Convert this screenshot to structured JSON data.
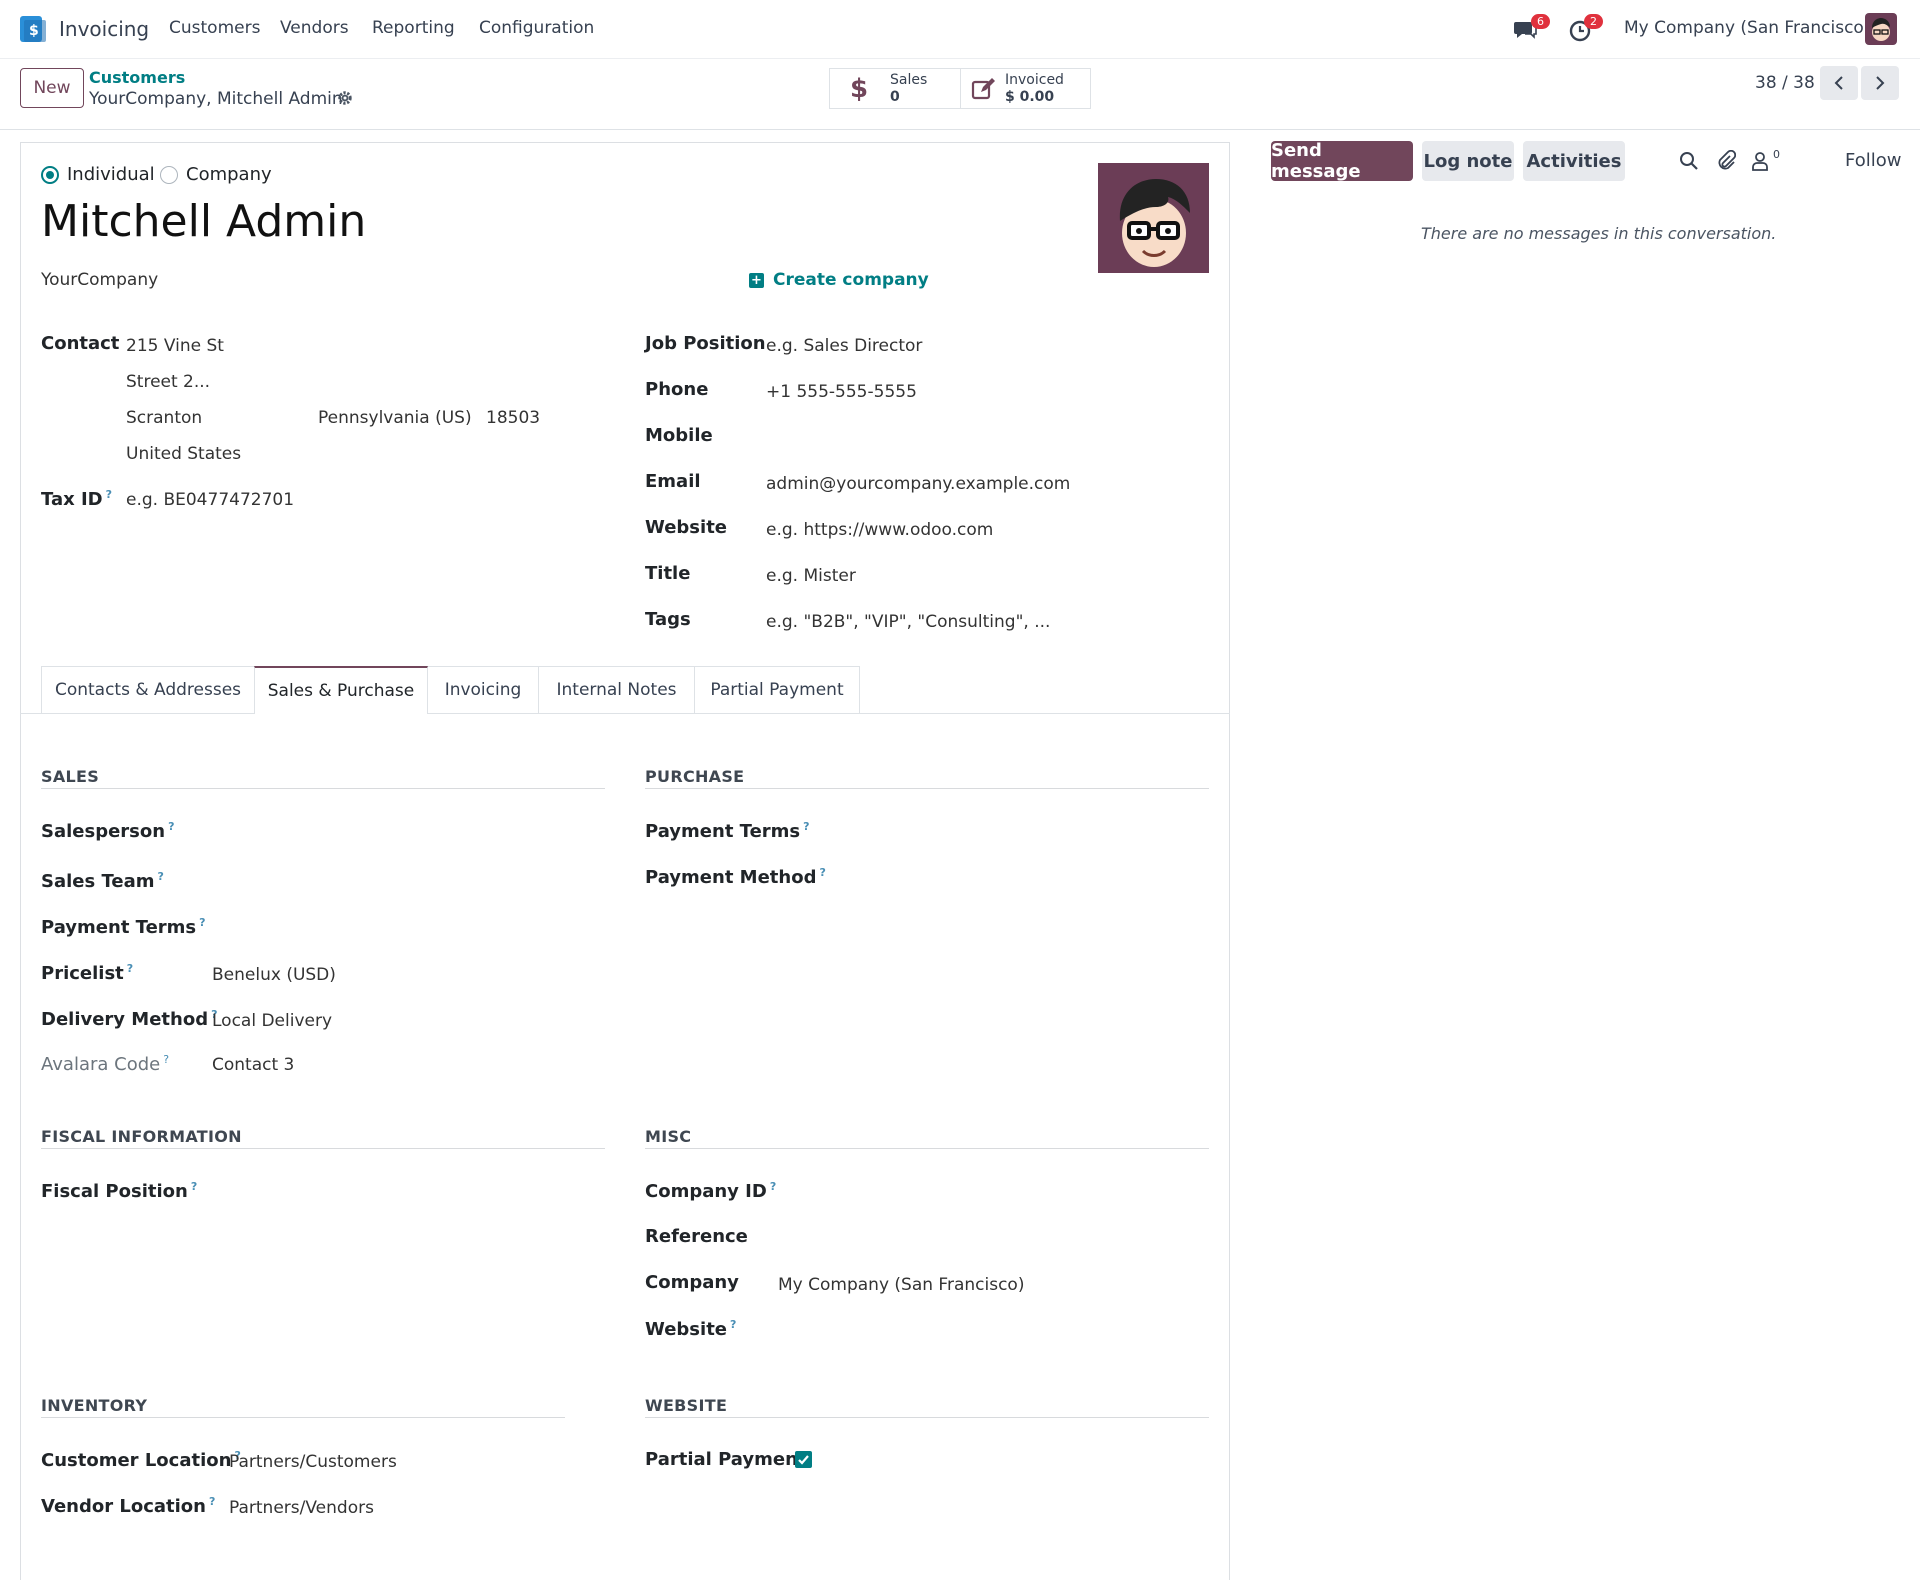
{
  "topbar": {
    "app_name": "Invoicing",
    "menu": [
      "Customers",
      "Vendors",
      "Reporting",
      "Configuration"
    ],
    "messages_badge": "6",
    "activities_badge": "2",
    "company": "My Company (San Francisco)"
  },
  "control": {
    "new_label": "New",
    "breadcrumb_parent": "Customers",
    "breadcrumb_current": "YourCompany, Mitchell Admin",
    "stat_sales_label": "Sales",
    "stat_sales_value": "0",
    "stat_invoiced_label": "Invoiced",
    "stat_invoiced_value": "$ 0.00",
    "pager": "38 / 38"
  },
  "form": {
    "type_individual": "Individual",
    "type_company": "Company",
    "name": "Mitchell Admin",
    "parent_company": "YourCompany",
    "create_company": "Create company",
    "contact_label": "Contact",
    "street": "215 Vine St",
    "street2_placeholder": "Street 2...",
    "city": "Scranton",
    "state": "Pennsylvania (US)",
    "zip": "18503",
    "country": "United States",
    "taxid_label": "Tax ID",
    "taxid_placeholder": "e.g. BE0477472701",
    "job_label": "Job Position",
    "job_placeholder": "e.g. Sales Director",
    "phone_label": "Phone",
    "phone": "+1 555-555-5555",
    "mobile_label": "Mobile",
    "email_label": "Email",
    "email": "admin@yourcompany.example.com",
    "website_label": "Website",
    "website_placeholder": "e.g. https://www.odoo.com",
    "title_label": "Title",
    "title_placeholder": "e.g. Mister",
    "tags_label": "Tags",
    "tags_placeholder": "e.g. \"B2B\", \"VIP\", \"Consulting\", ..."
  },
  "tabs": [
    "Contacts & Addresses",
    "Sales & Purchase",
    "Invoicing",
    "Internal Notes",
    "Partial Payment"
  ],
  "sales": {
    "title": "SALES",
    "salesperson": "Salesperson",
    "sales_team": "Sales Team",
    "payment_terms": "Payment Terms",
    "pricelist": "Pricelist",
    "pricelist_value": "Benelux (USD)",
    "delivery": "Delivery Method",
    "delivery_value": "Local Delivery",
    "avalara": "Avalara Code",
    "avalara_value": "Contact 3"
  },
  "purchase": {
    "title": "PURCHASE",
    "payment_terms": "Payment Terms",
    "payment_method": "Payment Method"
  },
  "fiscal": {
    "title": "FISCAL INFORMATION",
    "fiscal_position": "Fiscal Position"
  },
  "misc": {
    "title": "MISC",
    "company_id": "Company ID",
    "reference": "Reference",
    "company": "Company",
    "company_value": "My Company (San Francisco)",
    "website": "Website"
  },
  "inventory": {
    "title": "INVENTORY",
    "customer_location": "Customer Location",
    "customer_location_value": "Partners/Customers",
    "vendor_location": "Vendor Location",
    "vendor_location_value": "Partners/Vendors"
  },
  "website_sect": {
    "title": "WEBSITE",
    "partial_payment": "Partial Payment",
    "partial_payment_checked": true
  },
  "chatter": {
    "send_message": "Send message",
    "log_note": "Log note",
    "activities": "Activities",
    "followers_count": "0",
    "follow": "Follow",
    "empty": "There are no messages in this conversation."
  },
  "colors": {
    "brand": "#71465b",
    "link": "#017e84",
    "checkbox": "#017e84"
  }
}
